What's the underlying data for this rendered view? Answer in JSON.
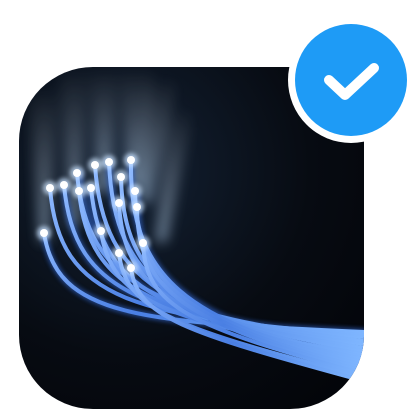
{
  "icon": {
    "name": "fiber-optic-cable-icon",
    "description_visible": "",
    "colors": {
      "background": "#05080e",
      "fiber": "#4f86e6",
      "fiber_glow": "#9cc8ff",
      "fiber_tip": "#ffffff"
    }
  },
  "badge": {
    "name": "check-mark-icon",
    "state": "verified",
    "colors": {
      "fill": "#1e9bf6",
      "check": "#ffffff",
      "ring": "#ffffff"
    }
  }
}
